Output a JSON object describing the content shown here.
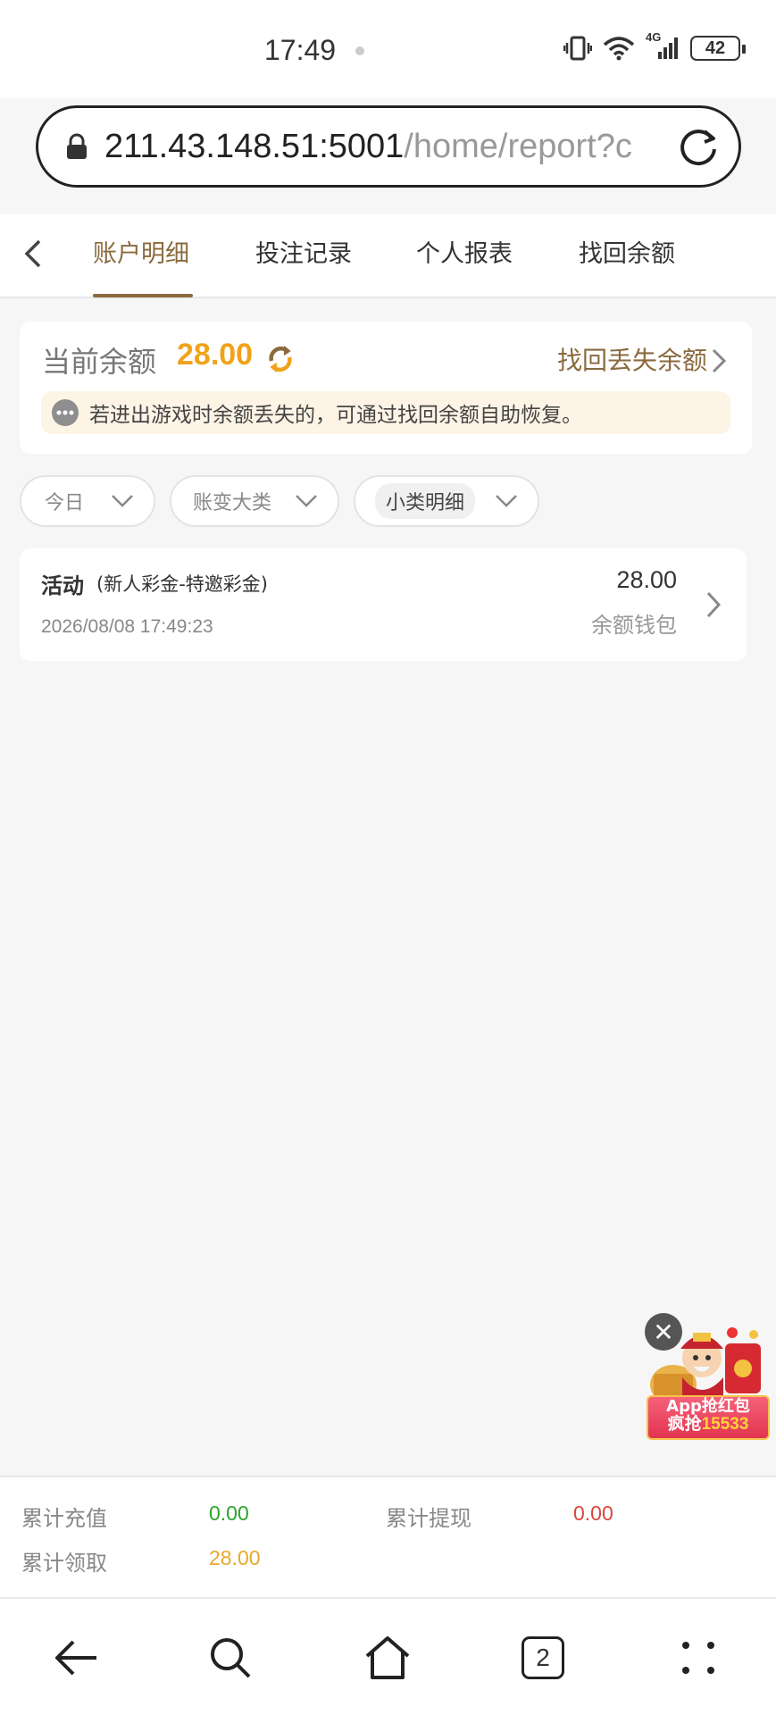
{
  "status_bar": {
    "time": "17:49",
    "network": "4G",
    "battery": "42"
  },
  "url_bar": {
    "host": "211.43.148.51:5001",
    "path": "/home/report?c"
  },
  "tabs": [
    {
      "label": "账户明细",
      "active": true
    },
    {
      "label": "投注记录",
      "active": false
    },
    {
      "label": "个人报表",
      "active": false
    },
    {
      "label": "找回余额",
      "active": false
    }
  ],
  "balance": {
    "label": "当前余额",
    "value": "28.00",
    "recover_link": "找回丢失余额",
    "tip": "若进出游戏时余额丢失的，可通过找回余额自助恢复。"
  },
  "filters": {
    "date": "今日",
    "category": "账变大类",
    "subcategory": "小类明细"
  },
  "records": [
    {
      "title": "活动",
      "subtitle": "(新人彩金-特邀彩金)",
      "datetime": "2026/08/08 17:49:23",
      "amount": "28.00",
      "wallet": "余额钱包"
    }
  ],
  "promo": {
    "line1": "App抢红包",
    "line2_prefix": "疯抢",
    "line2_number": "15533"
  },
  "summary": {
    "total_recharge_label": "累计充值",
    "total_recharge_value": "0.00",
    "total_withdraw_label": "累计提现",
    "total_withdraw_value": "0.00",
    "total_claimed_label": "累计领取",
    "total_claimed_value": "28.00"
  },
  "bottom_nav": {
    "tab_count": "2"
  },
  "colors": {
    "accent_brown": "#8a6a3e",
    "balance_orange": "#f0a21b",
    "green": "#2aa52a",
    "red": "#d9473f",
    "gold": "#e8a82a"
  }
}
